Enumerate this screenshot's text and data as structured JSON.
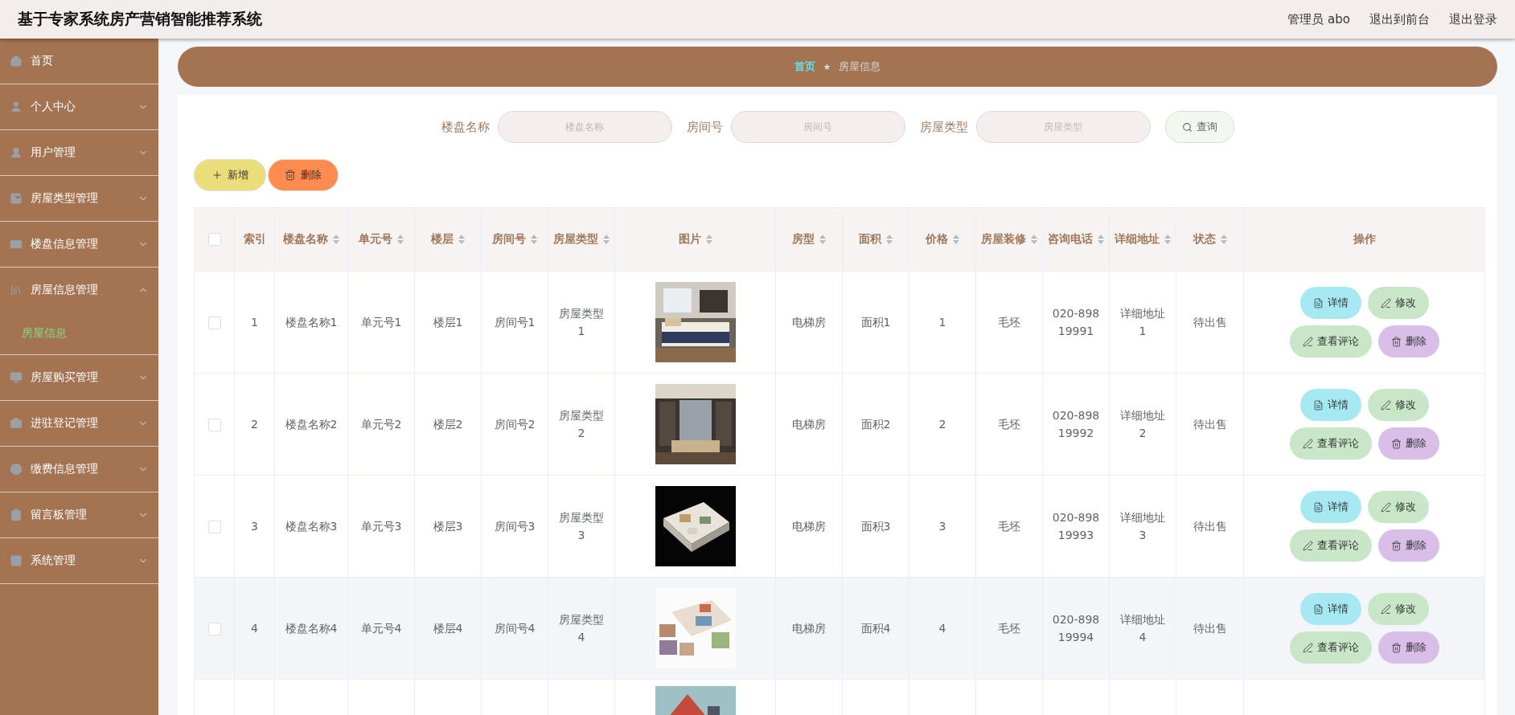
{
  "header": {
    "title": "基于专家系统房产营销智能推荐系统",
    "links": [
      "管理员 abo",
      "退出到前台",
      "退出登录"
    ]
  },
  "sidebar": {
    "items": [
      {
        "label": "首页",
        "expandable": false,
        "expanded": false
      },
      {
        "label": "个人中心",
        "expandable": true,
        "expanded": false
      },
      {
        "label": "用户管理",
        "expandable": true,
        "expanded": false
      },
      {
        "label": "房屋类型管理",
        "expandable": true,
        "expanded": false
      },
      {
        "label": "楼盘信息管理",
        "expandable": true,
        "expanded": false
      },
      {
        "label": "房屋信息管理",
        "expandable": true,
        "expanded": true,
        "children": [
          {
            "label": "房屋信息",
            "selected": true
          }
        ]
      },
      {
        "label": "房屋购买管理",
        "expandable": true,
        "expanded": false
      },
      {
        "label": "进驻登记管理",
        "expandable": true,
        "expanded": false
      },
      {
        "label": "缴费信息管理",
        "expandable": true,
        "expanded": false
      },
      {
        "label": "留言板管理",
        "expandable": true,
        "expanded": false
      },
      {
        "label": "系统管理",
        "expandable": true,
        "expanded": false
      }
    ]
  },
  "breadcrumb": {
    "items": [
      "首页",
      "房屋信息"
    ],
    "separator": "★"
  },
  "search": {
    "fields": [
      {
        "label": "楼盘名称",
        "placeholder": "楼盘名称"
      },
      {
        "label": "房间号",
        "placeholder": "房间号"
      },
      {
        "label": "房屋类型",
        "placeholder": "房屋类型"
      }
    ],
    "button": "查询"
  },
  "toolbar": [
    {
      "label": "新增",
      "kind": "add"
    },
    {
      "label": "删除",
      "kind": "delete"
    }
  ],
  "table": {
    "header_checked": false,
    "columns": [
      {
        "label": "索引",
        "sortable": false
      },
      {
        "label": "楼盘名称",
        "sortable": true
      },
      {
        "label": "单元号",
        "sortable": true
      },
      {
        "label": "楼层",
        "sortable": true
      },
      {
        "label": "房间号",
        "sortable": true
      },
      {
        "label": "房屋类型",
        "sortable": true
      },
      {
        "label": "图片",
        "sortable": true
      },
      {
        "label": "房型",
        "sortable": true
      },
      {
        "label": "面积",
        "sortable": true
      },
      {
        "label": "价格",
        "sortable": true
      },
      {
        "label": "房屋装修",
        "sortable": true
      },
      {
        "label": "咨询电话",
        "sortable": true
      },
      {
        "label": "详细地址",
        "sortable": true
      },
      {
        "label": "状态",
        "sortable": true
      },
      {
        "label": "操作",
        "sortable": false
      }
    ],
    "rows": [
      {
        "checked": false,
        "highlighted": false,
        "cells": [
          "1",
          "楼盘名称1",
          "单元号1",
          "楼层1",
          "房间号1",
          "房屋类型1",
          {
            "kind": "picture"
          },
          "电梯房",
          "面积1",
          "1",
          "毛坯",
          "020-89819991",
          "详细地址1",
          "待出售"
        ],
        "actions": [
          {
            "label": "详情",
            "kind": "detail"
          },
          {
            "label": "修改",
            "kind": "edit"
          },
          {
            "label": "查看评论",
            "kind": "comments"
          },
          {
            "label": "删除",
            "kind": "delete"
          }
        ]
      },
      {
        "checked": false,
        "highlighted": false,
        "cells": [
          "2",
          "楼盘名称2",
          "单元号2",
          "楼层2",
          "房间号2",
          "房屋类型2",
          {
            "kind": "picture"
          },
          "电梯房",
          "面积2",
          "2",
          "毛坯",
          "020-89819992",
          "详细地址2",
          "待出售"
        ],
        "actions": [
          {
            "label": "详情",
            "kind": "detail"
          },
          {
            "label": "修改",
            "kind": "edit"
          },
          {
            "label": "查看评论",
            "kind": "comments"
          },
          {
            "label": "删除",
            "kind": "delete"
          }
        ]
      },
      {
        "checked": false,
        "highlighted": false,
        "cells": [
          "3",
          "楼盘名称3",
          "单元号3",
          "楼层3",
          "房间号3",
          "房屋类型3",
          {
            "kind": "picture"
          },
          "电梯房",
          "面积3",
          "3",
          "毛坯",
          "020-89819993",
          "详细地址3",
          "待出售"
        ],
        "actions": [
          {
            "label": "详情",
            "kind": "detail"
          },
          {
            "label": "修改",
            "kind": "edit"
          },
          {
            "label": "查看评论",
            "kind": "comments"
          },
          {
            "label": "删除",
            "kind": "delete"
          }
        ]
      },
      {
        "checked": false,
        "highlighted": true,
        "cells": [
          "4",
          "楼盘名称4",
          "单元号4",
          "楼层4",
          "房间号4",
          "房屋类型4",
          {
            "kind": "picture"
          },
          "电梯房",
          "面积4",
          "4",
          "毛坯",
          "020-89819994",
          "详细地址4",
          "待出售"
        ],
        "actions": [
          {
            "label": "详情",
            "kind": "detail"
          },
          {
            "label": "修改",
            "kind": "edit"
          },
          {
            "label": "查看评论",
            "kind": "comments"
          },
          {
            "label": "删除",
            "kind": "delete"
          }
        ]
      },
      {
        "cells": [
          null,
          null,
          null,
          null,
          null,
          null,
          {
            "kind": "picture"
          }
        ]
      }
    ]
  }
}
